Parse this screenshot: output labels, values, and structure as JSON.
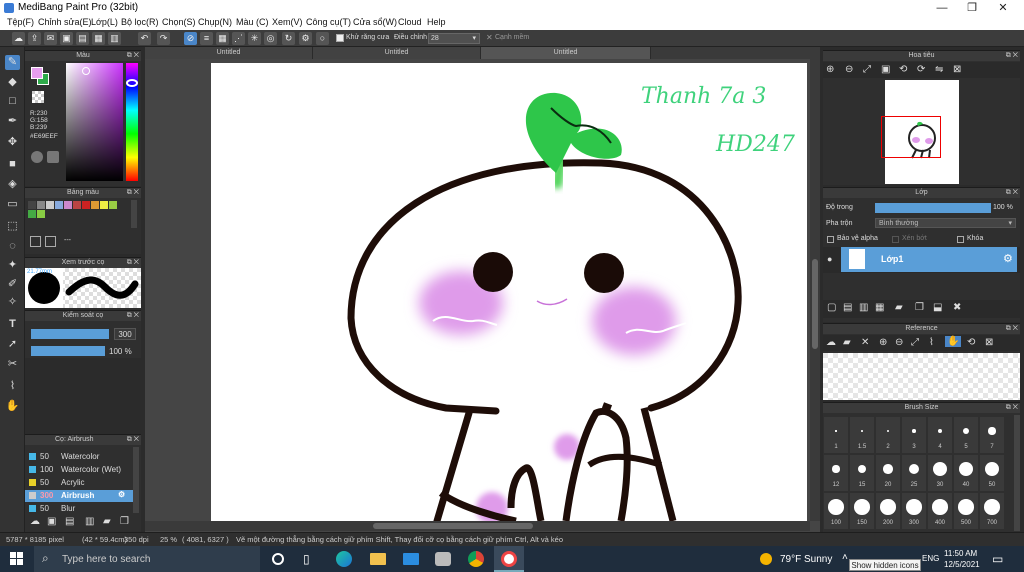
{
  "app": {
    "title": "MediBang Paint Pro (32bit)"
  },
  "menu": [
    "Tệp(F)",
    "Chỉnh sửa(E)",
    "Lớp(L)",
    "Bộ lọc(R)",
    "Chọn(S)",
    "Chụp(N)",
    "Màu (C)",
    "Xem(V)",
    "Công cụ(T)",
    "Cửa sổ(W)",
    "Cloud",
    "Help"
  ],
  "toolbar": {
    "antialias_label": "Khử răng cưa",
    "adjust_label": "Điều chỉnh",
    "adjust_value": "28",
    "smooth_label": "Cạnh mềm"
  },
  "tabs": [
    "Untitled",
    "Untitled",
    "Untitled"
  ],
  "color_panel": {
    "title": "Màu",
    "r": "R:230",
    "g": "G:158",
    "b": "B:239",
    "hex": "#E69EEF",
    "fg": "#e69eef",
    "bg": "#2eaa4a"
  },
  "palette_panel": {
    "title": "Bảng màu",
    "dashes": "---"
  },
  "preview_panel": {
    "title": "Xem trước cọ",
    "size": "21.77mm"
  },
  "brush_control": {
    "title": "Kiểm soát cọ",
    "size": "300",
    "opacity": "100 %"
  },
  "brush_list": {
    "title": "Cọ: Airbrush",
    "items": [
      {
        "size": "50",
        "name": "Watercolor",
        "color": "#46b8e8"
      },
      {
        "size": "100",
        "name": "Watercolor (Wet)",
        "color": "#46b8e8"
      },
      {
        "size": "50",
        "name": "Acrylic",
        "color": "#e8d028"
      },
      {
        "size": "300",
        "name": "Airbrush",
        "color": "#cccccc"
      },
      {
        "size": "50",
        "name": "Blur",
        "color": "#46b8e8"
      }
    ]
  },
  "navigator": {
    "title": "Hoa tiêu"
  },
  "layer_panel": {
    "title": "Lớp",
    "opacity_label": "Độ trong",
    "opacity_value": "100 %",
    "blend_label": "Pha trộn",
    "blend_value": "Bình thường",
    "protect_alpha": "Bảo vệ alpha",
    "clipping": "Xén bớt",
    "lock": "Khóa",
    "layer_name": "Lớp1"
  },
  "reference_panel": {
    "title": "Reference"
  },
  "brush_size_panel": {
    "title": "Brush Size",
    "sizes": [
      "1",
      "1.5",
      "2",
      "3",
      "4",
      "5",
      "7",
      "12",
      "15",
      "20",
      "25",
      "30",
      "40",
      "50",
      "100",
      "150",
      "200",
      "300",
      "400",
      "500",
      "700"
    ]
  },
  "handwriting": {
    "line1": "Thanh 7a 3",
    "line2": "HD247"
  },
  "status": {
    "dimensions": "5787 * 8185 pixel",
    "mm": "(42 * 59.4cm)",
    "dpi": "350 dpi",
    "zoom": "25 %",
    "coords": "( 4081, 6327 )",
    "hint": "Vẽ một đường thẳng bằng cách giữ phím Shift, Thay đổi cỡ cọ bằng cách giữ phím Ctrl, Alt và kéo"
  },
  "taskbar": {
    "search_placeholder": "Type here to search",
    "weather": "79°F  Sunny",
    "lang": "ENG",
    "time": "11:50 AM",
    "date": "12/5/2021",
    "tooltip": "Show hidden icons"
  }
}
